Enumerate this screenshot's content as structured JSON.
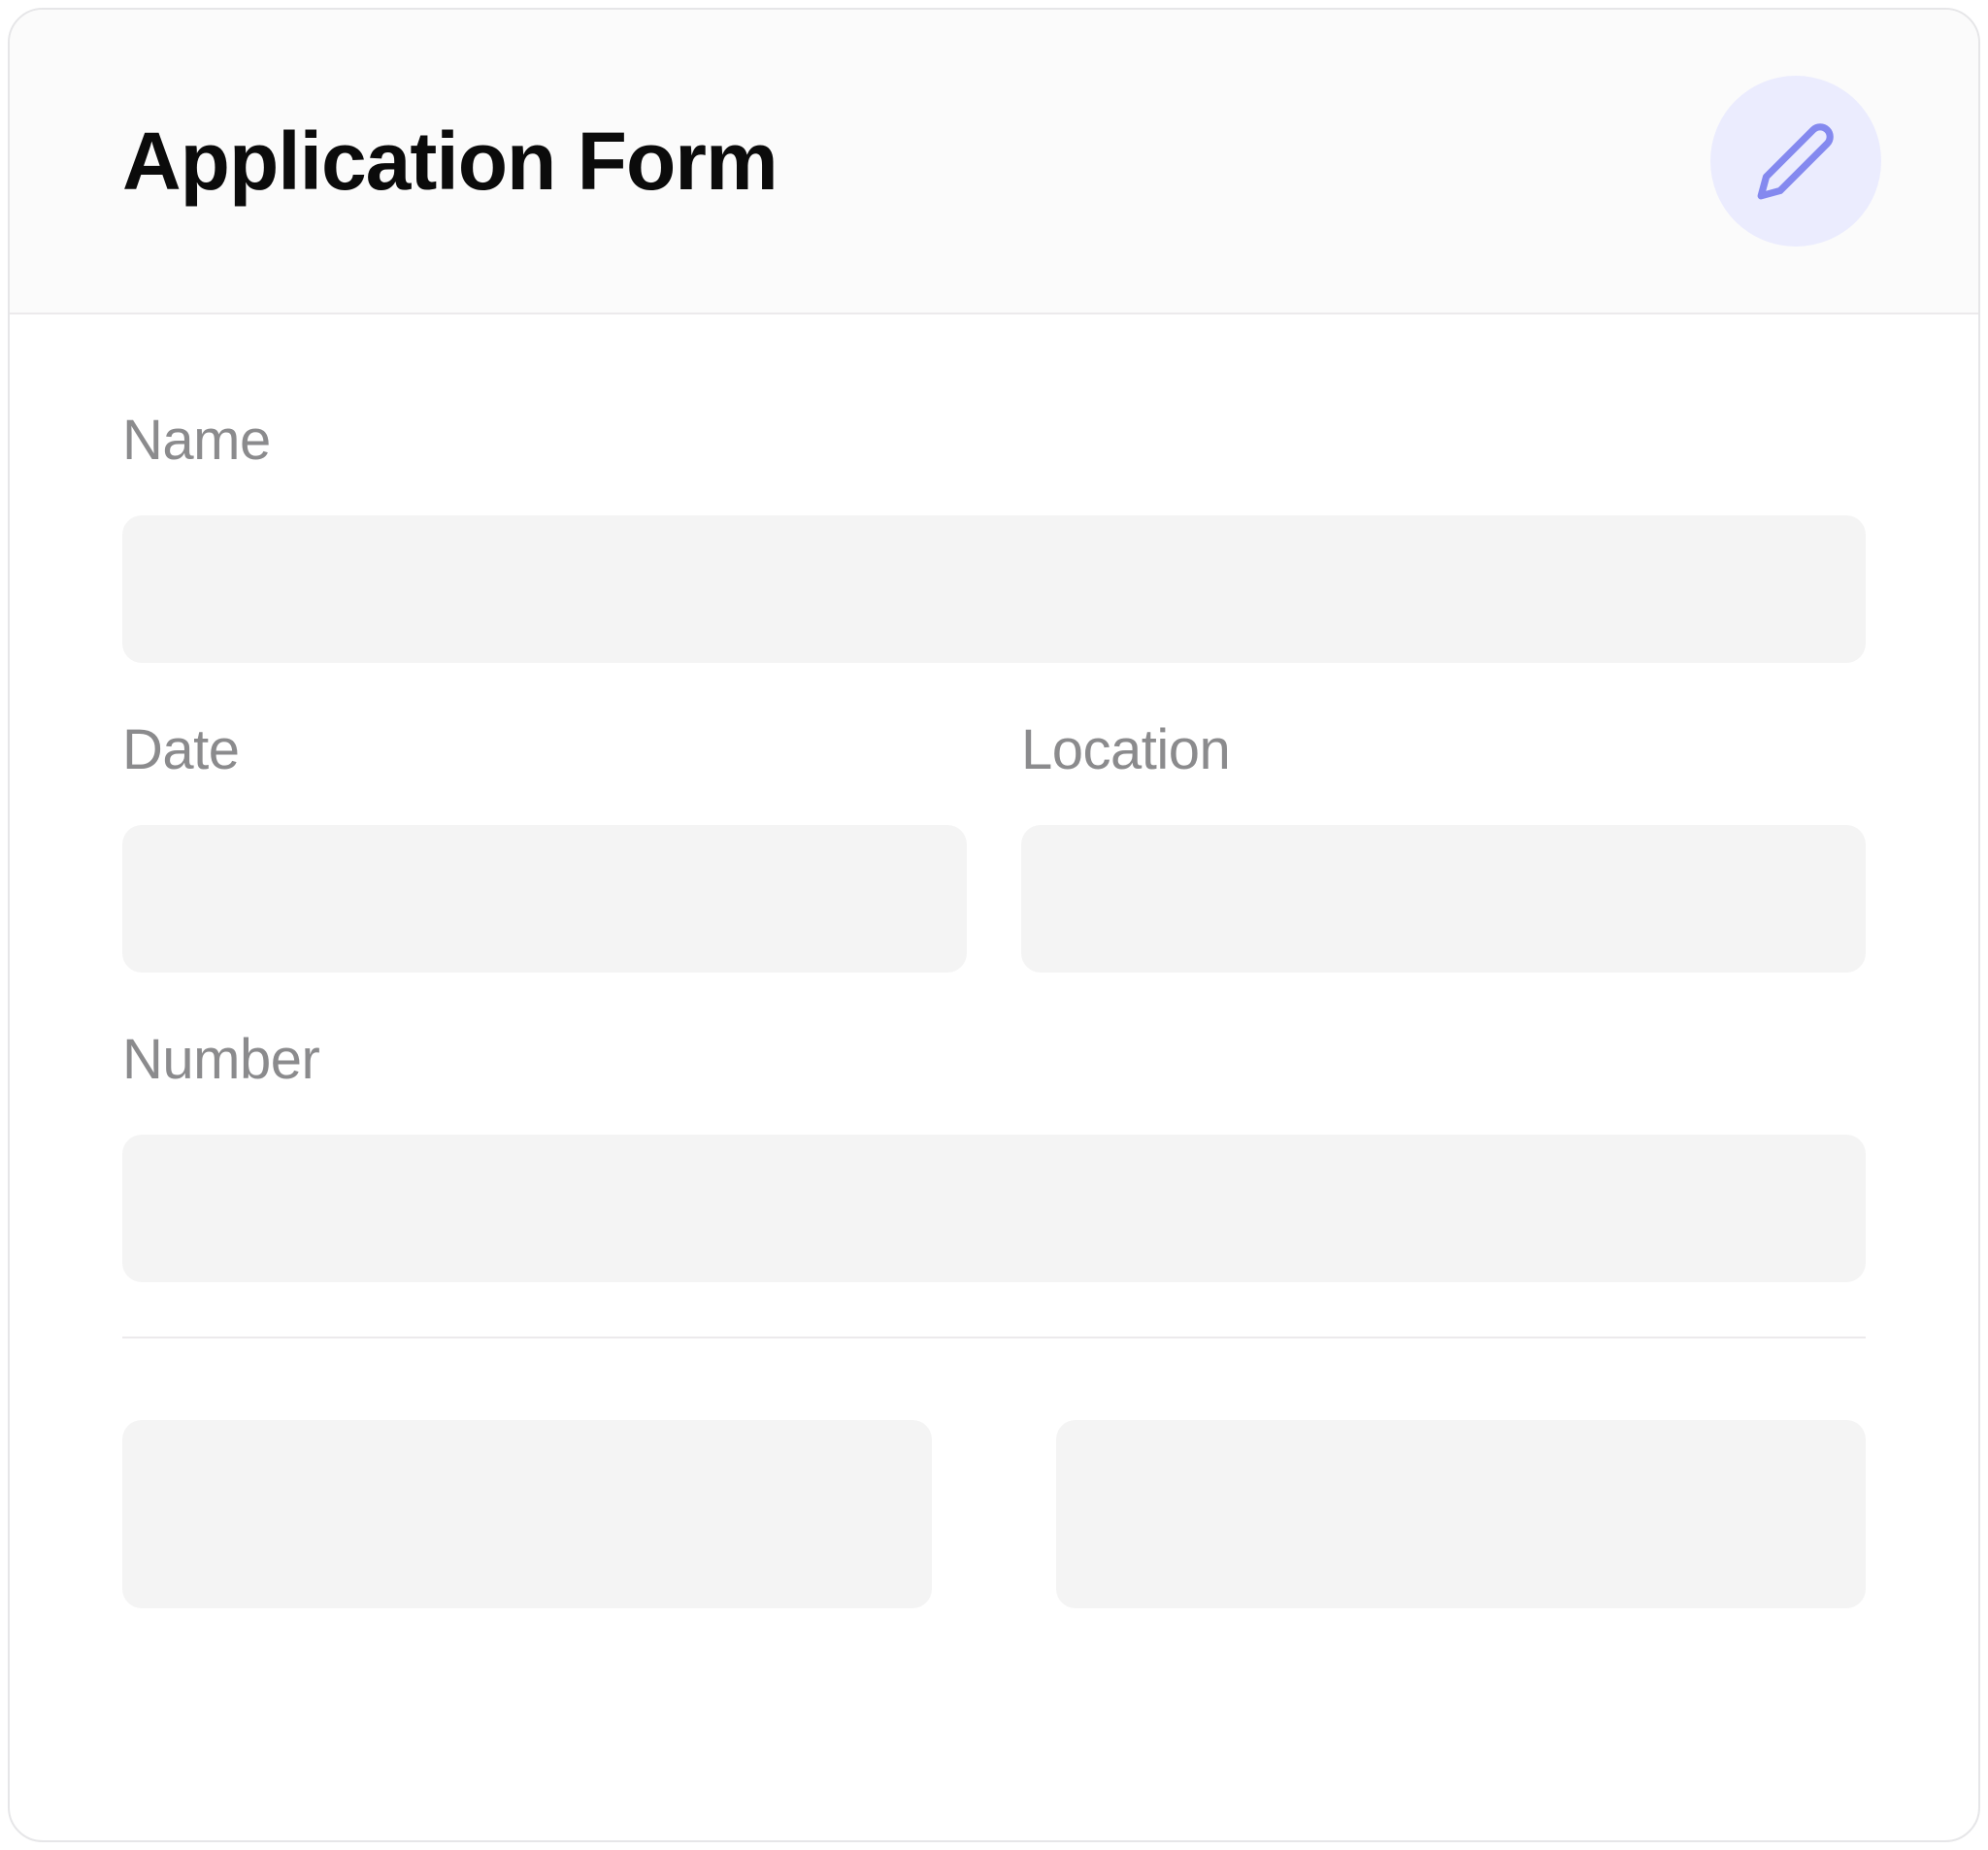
{
  "header": {
    "title": "Application Form"
  },
  "fields": {
    "name": {
      "label": "Name",
      "value": ""
    },
    "date": {
      "label": "Date",
      "value": ""
    },
    "location": {
      "label": "Location",
      "value": ""
    },
    "number": {
      "label": "Number",
      "value": ""
    }
  },
  "buttons": {
    "left": {
      "label": ""
    },
    "right": {
      "label": ""
    }
  }
}
